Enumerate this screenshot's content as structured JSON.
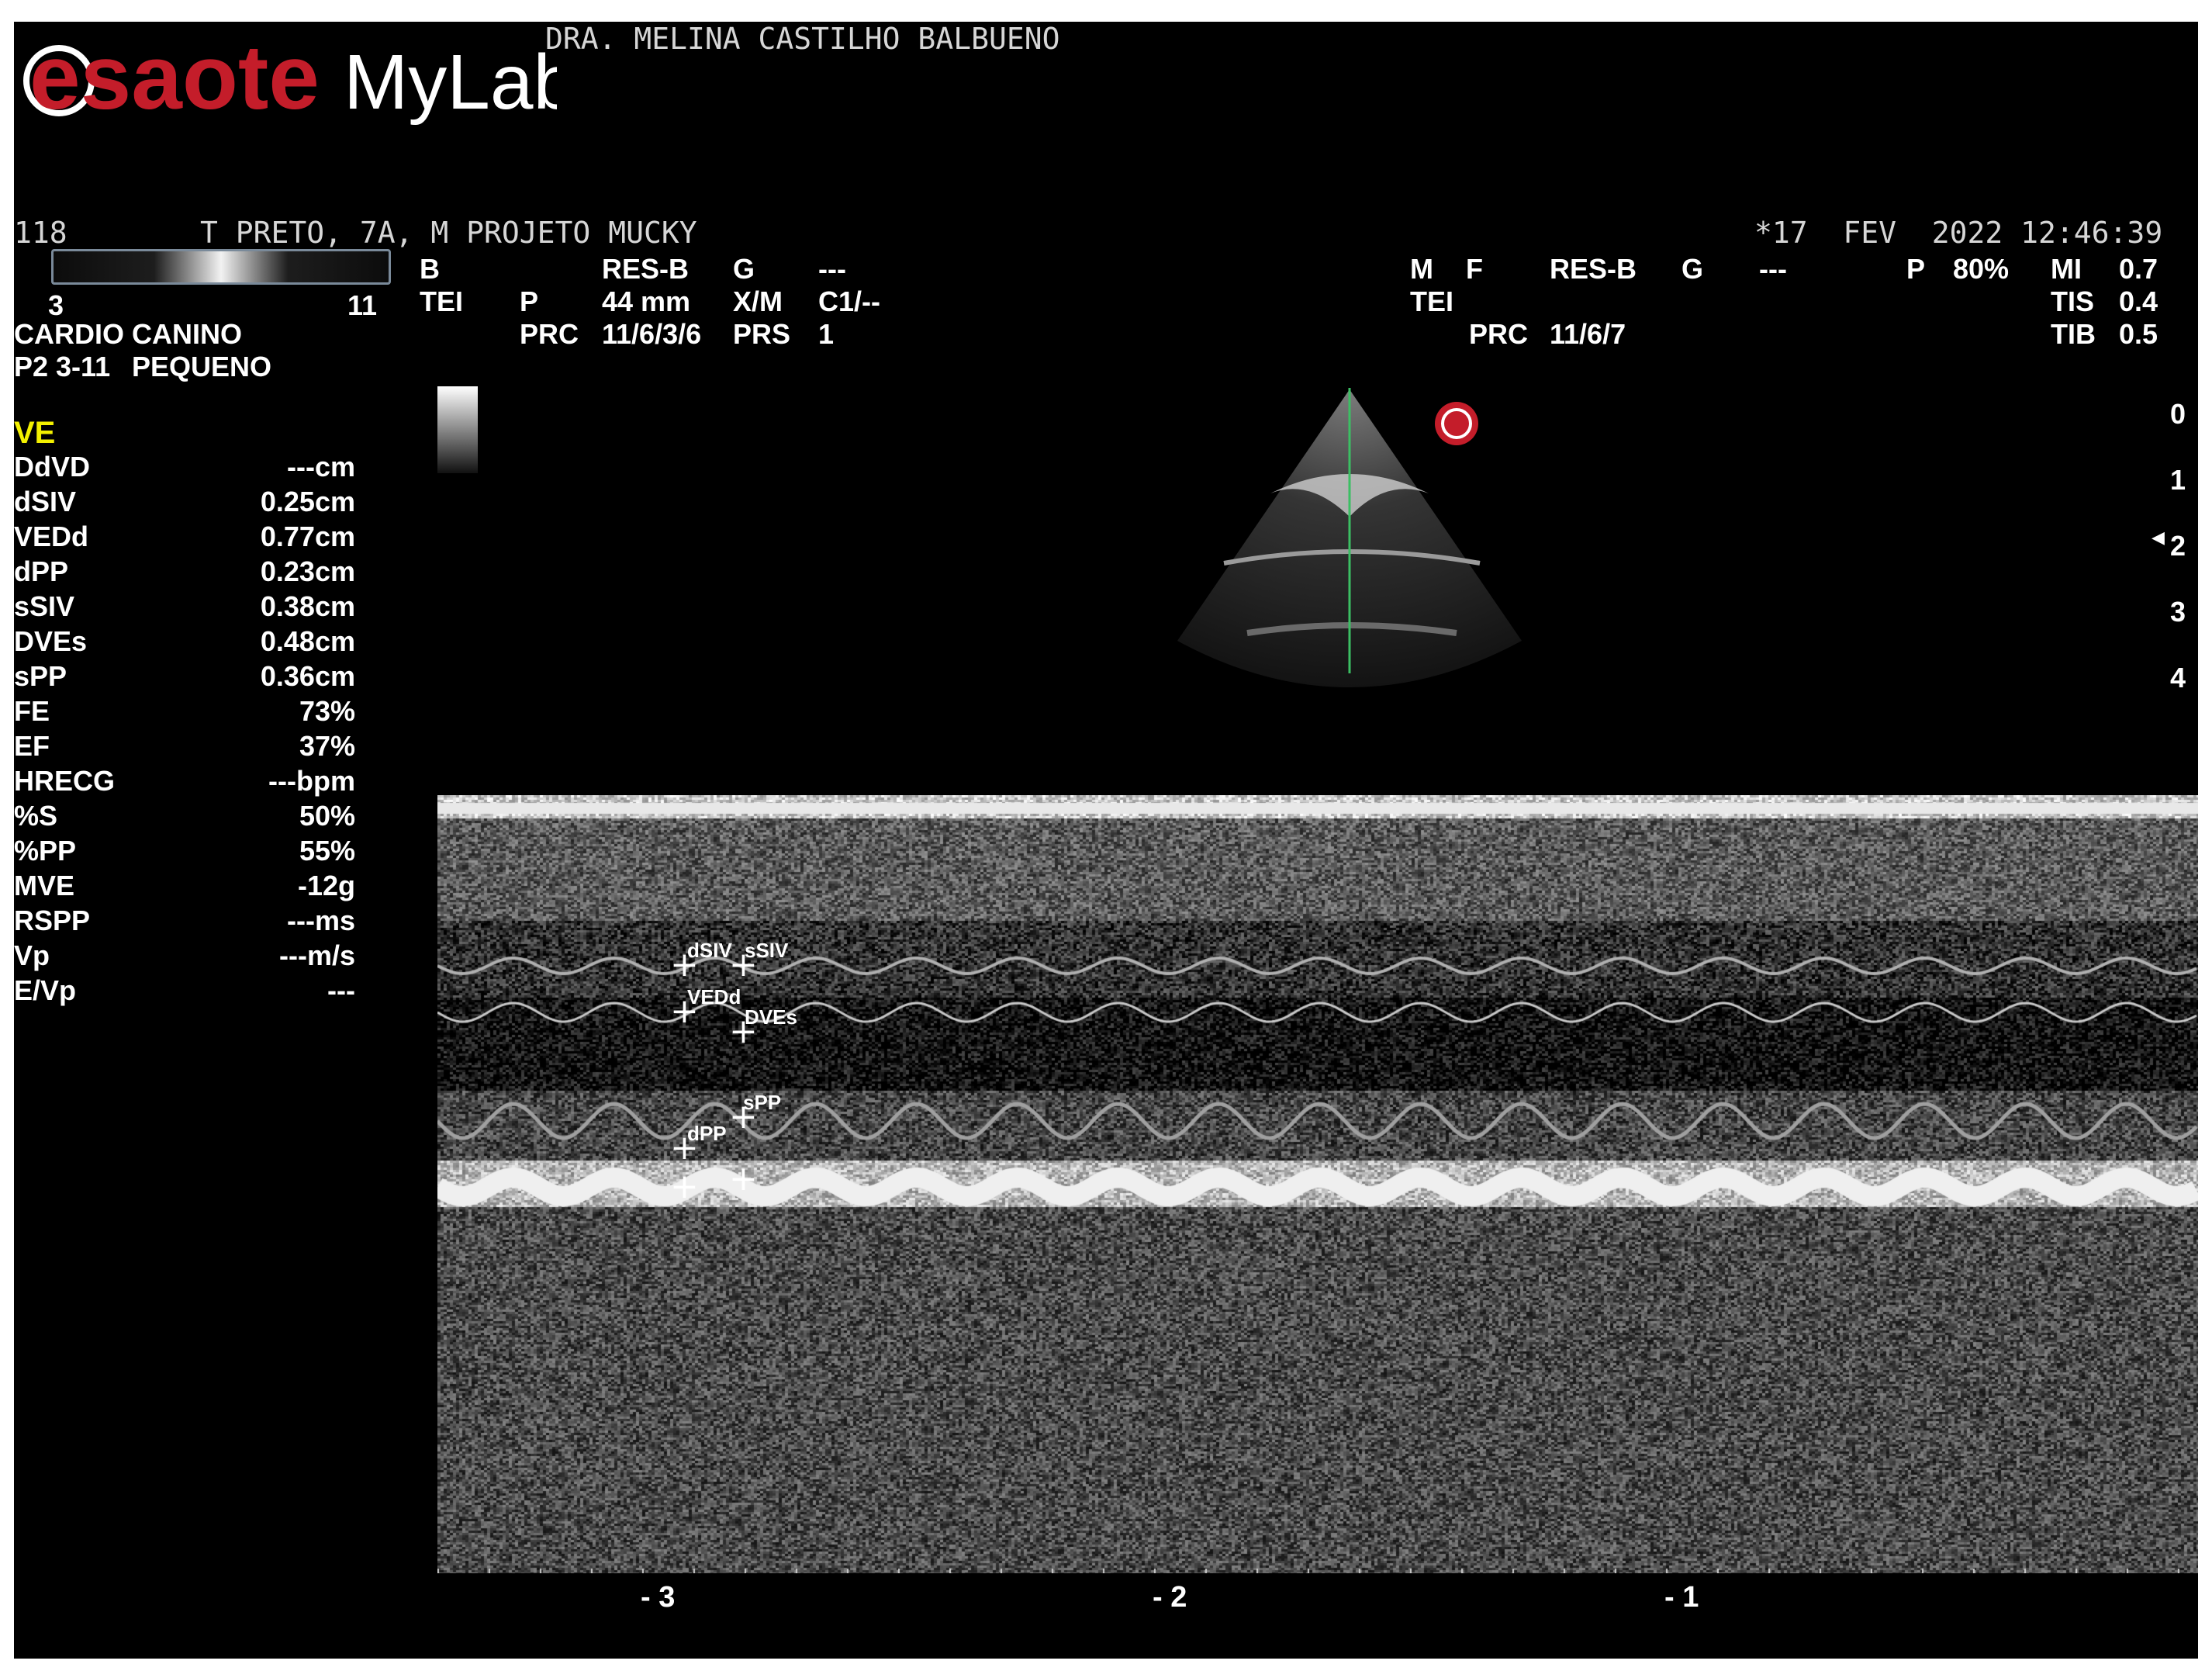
{
  "brand": {
    "logo_primary": "esaote",
    "logo_secondary": "MyLab",
    "accent": "#c41d2a"
  },
  "operator": "DRA. MELINA CASTILHO BALBUENO",
  "patient": {
    "id": "118",
    "info": "T PRETO, 7A, M PROJETO MUCKY"
  },
  "datetime": "*17  FEV  2022 12:46:39",
  "grayscale": {
    "min": "3",
    "max": "11"
  },
  "exam": {
    "preset": "CARDIO CANINO",
    "probe": "P2 3-11",
    "probe_size": "PEQUENO"
  },
  "params_b": {
    "r1": [
      "B",
      "RES-B",
      "G",
      "---"
    ],
    "r2": [
      "TEI",
      "P",
      "44 mm",
      "X/M",
      "C1/--"
    ],
    "r3": [
      "PRC",
      "11/6/3/6",
      "PRS",
      "1"
    ]
  },
  "params_m": {
    "r1": [
      "M",
      "F",
      "RES-B",
      "G",
      "---",
      "P",
      "80%"
    ],
    "r2": [
      "TEI"
    ],
    "r3": [
      "PRC",
      "11/6/7"
    ]
  },
  "safety": [
    {
      "label": "MI",
      "value": "0.7"
    },
    {
      "label": "TIS",
      "value": "0.4"
    },
    {
      "label": "TIB",
      "value": "0.5"
    }
  ],
  "depth_scale": [
    "0",
    "1",
    "2",
    "3",
    "4"
  ],
  "measurements": {
    "title": "VE",
    "items": [
      {
        "label": "DdVD",
        "value": "---cm"
      },
      {
        "label": "dSIV",
        "value": "0.25cm"
      },
      {
        "label": "VEDd",
        "value": "0.77cm"
      },
      {
        "label": "dPP",
        "value": "0.23cm"
      },
      {
        "label": "sSIV",
        "value": "0.38cm"
      },
      {
        "label": "DVEs",
        "value": "0.48cm"
      },
      {
        "label": "sPP",
        "value": "0.36cm"
      },
      {
        "label": "FE",
        "value": "73%"
      },
      {
        "label": "EF",
        "value": "37%"
      },
      {
        "label": "HRECG",
        "value": "---bpm"
      },
      {
        "label": "%S",
        "value": "50%"
      },
      {
        "label": "%PP",
        "value": "55%"
      },
      {
        "label": "MVE",
        "value": "-12g"
      },
      {
        "label": "RSPP",
        "value": "---ms"
      },
      {
        "label": "Vp",
        "value": "---m/s"
      },
      {
        "label": "E/Vp",
        "value": "---"
      }
    ]
  },
  "time_axis": [
    "- 3",
    "- 2",
    "- 1"
  ],
  "markers": [
    "dSIV",
    "sSIV",
    "VEDd",
    "DVEs",
    "sPP",
    "dPP"
  ]
}
